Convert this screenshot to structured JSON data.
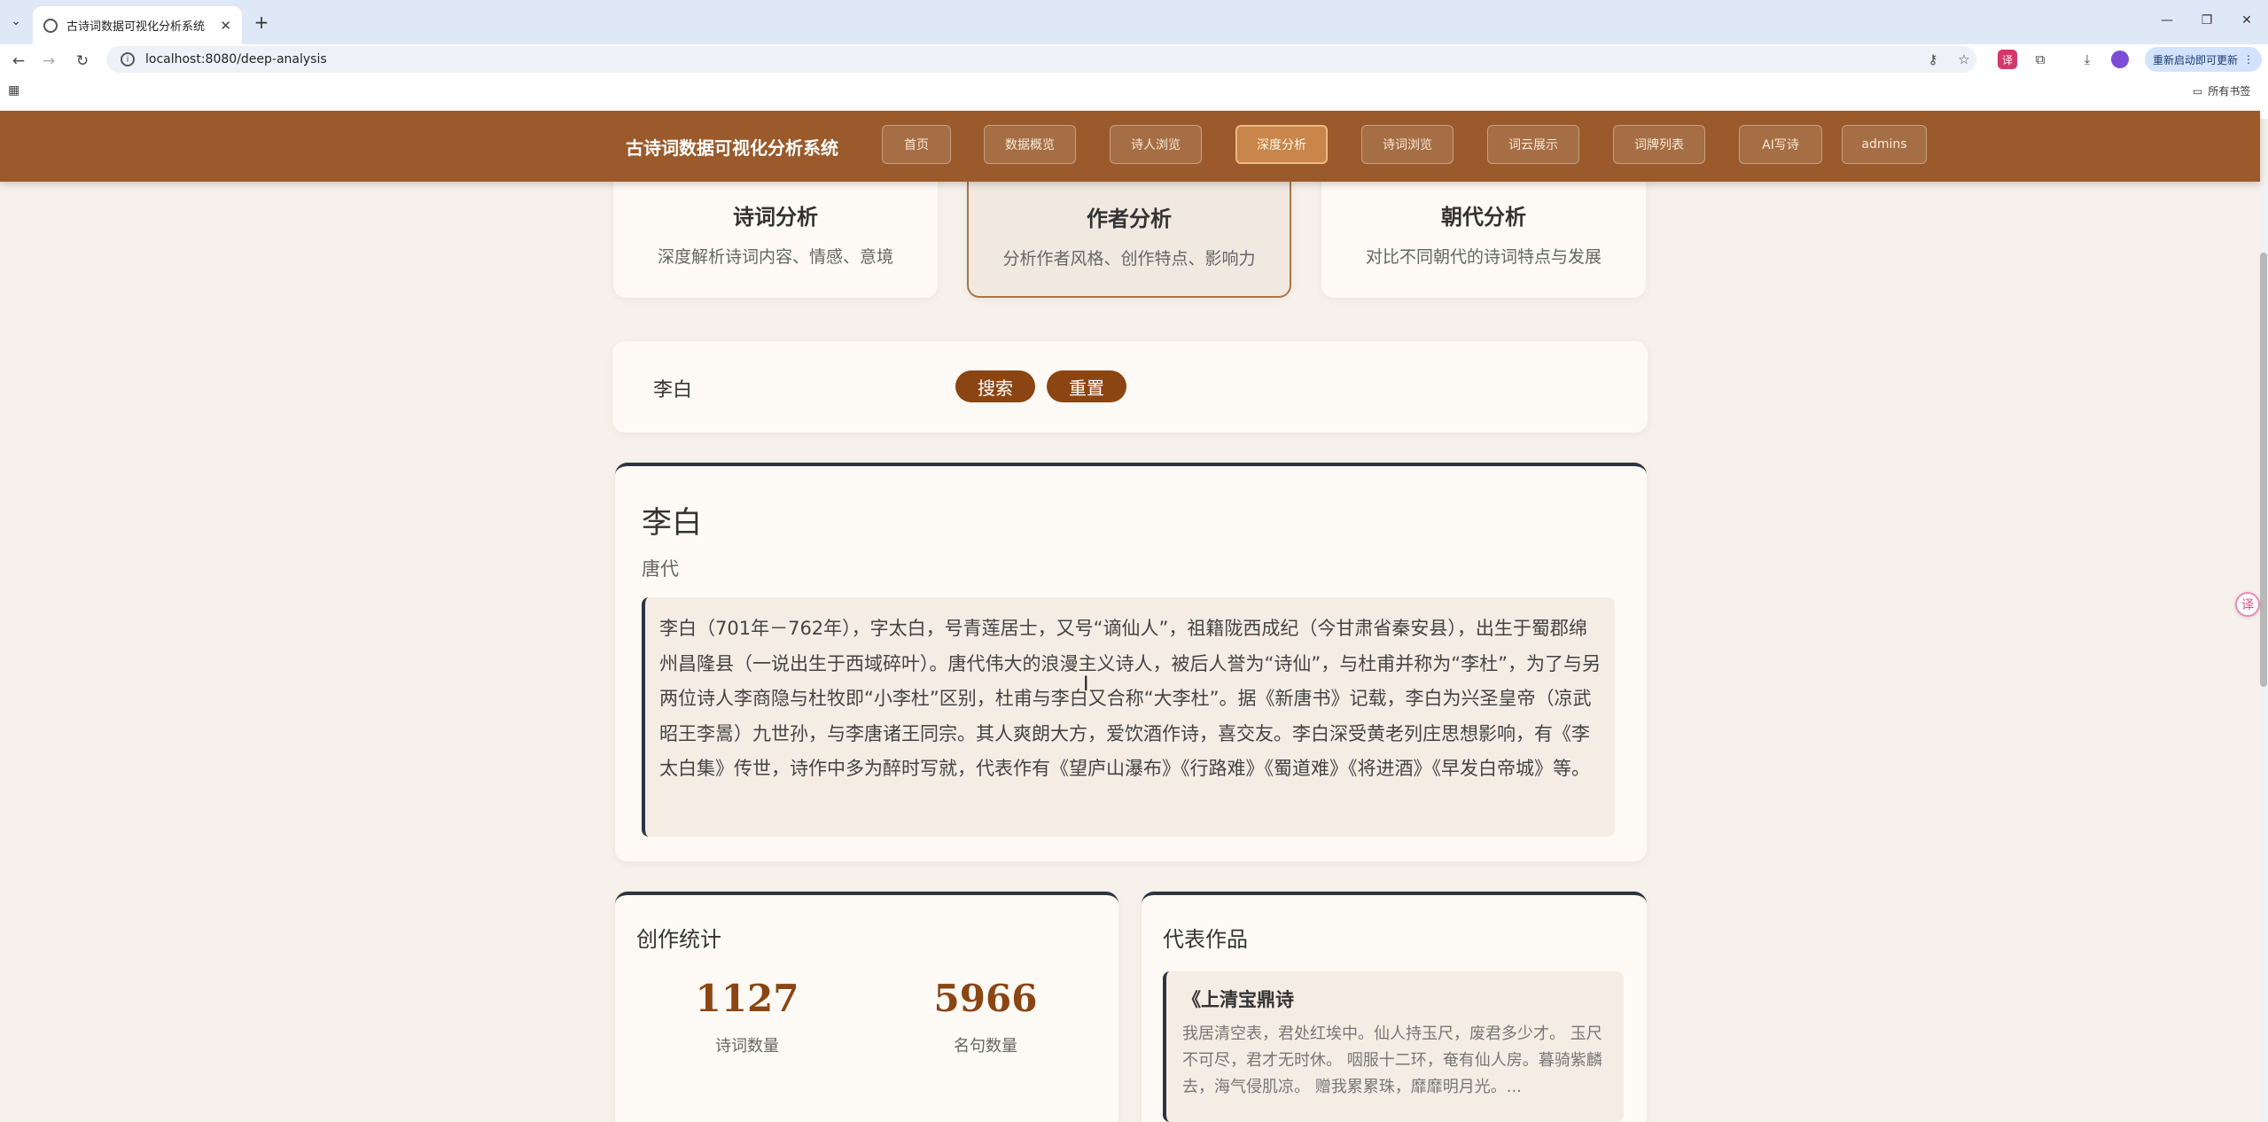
{
  "browser": {
    "tab_title": "古诗词数据可视化分析系统",
    "url": "localhost:8080/deep-analysis",
    "update_label": "重新启动即可更新",
    "bookmarks_label": "所有书签"
  },
  "header": {
    "title": "古诗词数据可视化分析系统",
    "nav": [
      {
        "label": "首页"
      },
      {
        "label": "数据概览"
      },
      {
        "label": "诗人浏览"
      },
      {
        "label": "深度分析",
        "active": true
      },
      {
        "label": "诗词浏览"
      },
      {
        "label": "词云展示"
      },
      {
        "label": "词牌列表"
      },
      {
        "label": "AI写诗"
      },
      {
        "label": "admins"
      }
    ]
  },
  "categories": [
    {
      "title": "诗词分析",
      "desc": "深度解析诗词内容、情感、意境"
    },
    {
      "title": "作者分析",
      "desc": "分析作者风格、创作特点、影响力",
      "active": true
    },
    {
      "title": "朝代分析",
      "desc": "对比不同朝代的诗词特点与发展"
    }
  ],
  "search": {
    "value": "李白",
    "search_label": "搜索",
    "reset_label": "重置"
  },
  "author": {
    "name": "李白",
    "dynasty": "唐代",
    "bio": "李白（701年－762年），字太白，号青莲居士，又号“谪仙人”，祖籍陇西成纪（今甘肃省秦安县），出生于蜀郡绵州昌隆县（一说出生于西域碎叶）。唐代伟大的浪漫主义诗人，被后人誉为“诗仙”，与杜甫并称为“李杜”，为了与另两位诗人李商隐与杜牧即“小李杜”区别，杜甫与李白又合称“大李杜”。据《新唐书》记载，李白为兴圣皇帝（凉武昭王李暠）九世孙，与李唐诸王同宗。其人爽朗大方，爱饮酒作诗，喜交友。李白深受黄老列庄思想影响，有《李太白集》传世，诗作中多为醉时写就，代表作有《望庐山瀑布》《行路难》《蜀道难》《将进酒》《早发白帝城》等。"
  },
  "stats": {
    "title": "创作统计",
    "poem_count": "1127",
    "poem_count_label": "诗词数量",
    "quote_count": "5966",
    "quote_count_label": "名句数量"
  },
  "representative": {
    "title": "代表作品",
    "poems": [
      {
        "title": "《上清宝鼎诗",
        "excerpt": "我居清空表，君处红埃中。仙人持玉尺，废君多少才。 玉尺不可尽，君才无时休。 咽服十二环，奄有仙人房。暮骑紫麟去，海气侵肌凉。 赠我累累珠，靡靡明月光。..."
      }
    ]
  },
  "colors": {
    "header_brown": "#9a5a2b",
    "button_brown": "#8b4513",
    "accent_dark": "#2e3440",
    "page_bg": "#f6f1ea"
  }
}
